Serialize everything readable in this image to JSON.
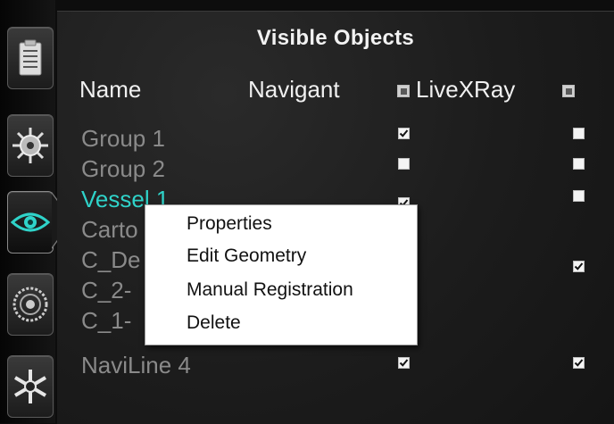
{
  "panel": {
    "title": "Visible Objects",
    "columns": {
      "name": "Name",
      "navigant": "Navigant",
      "livexray": "LiveXRay"
    }
  },
  "rail": {
    "items": [
      {
        "icon": "clipboard-icon"
      },
      {
        "icon": "gear-wheel-icon"
      },
      {
        "icon": "eye-icon",
        "active": true
      },
      {
        "icon": "target-dial-icon"
      },
      {
        "icon": "snowflake-icon"
      }
    ]
  },
  "rows": [
    {
      "name": "Group 1",
      "navigant": true,
      "livexray": false,
      "selected": false
    },
    {
      "name": "Group 2",
      "navigant": false,
      "livexray": false,
      "selected": false
    },
    {
      "name": "Vessel 1",
      "navigant": true,
      "livexray": false,
      "selected": true
    },
    {
      "name": "Carto",
      "selected": false
    },
    {
      "name": "C_De",
      "livexray": true,
      "selected": false
    },
    {
      "name": "C_2-",
      "selected": false
    },
    {
      "name": "C_1-",
      "selected": false
    },
    {
      "name": "NaviLine 4",
      "navigant": true,
      "livexray": true,
      "selected": false
    }
  ],
  "context_menu": {
    "items": [
      "Properties",
      "Edit Geometry",
      "Manual Registration",
      "Delete"
    ]
  },
  "colors": {
    "selected_text": "#2fd3c9",
    "inactive_text": "#8a8a8a",
    "header_text": "#f0f0f0"
  }
}
